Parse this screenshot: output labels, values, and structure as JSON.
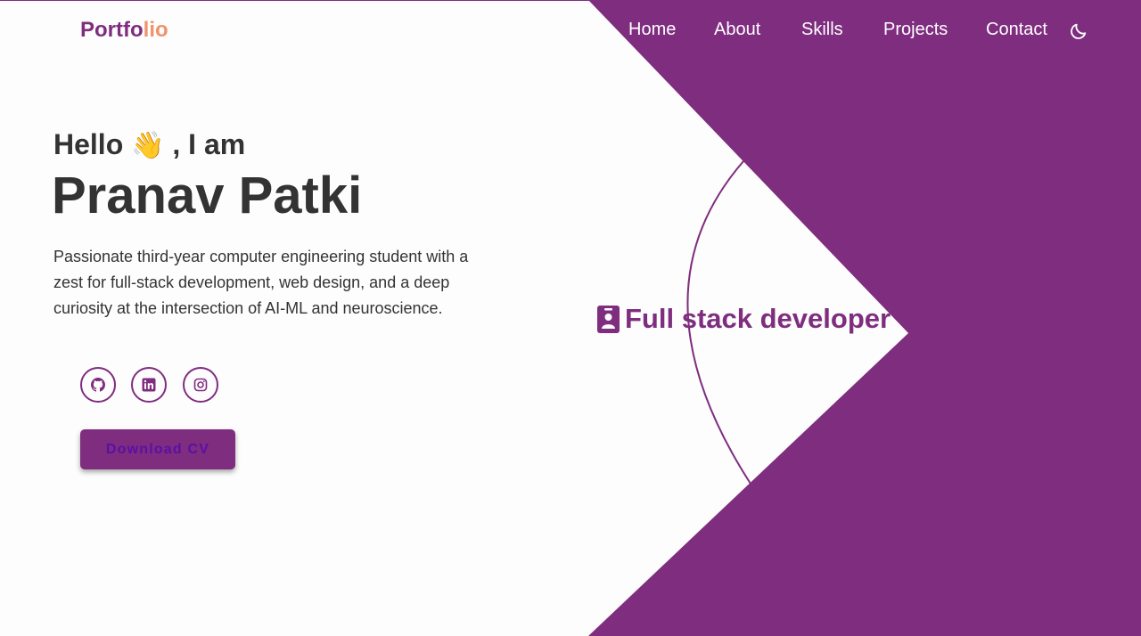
{
  "brand": {
    "logo_part1": "Portfo",
    "logo_part2": "lio",
    "colors": {
      "primary": "#7f2d7f",
      "accent": "#f0936b",
      "text": "#333333",
      "background": "#fdfdfd"
    }
  },
  "nav": {
    "items": [
      {
        "label": "Home"
      },
      {
        "label": "About"
      },
      {
        "label": "Skills"
      },
      {
        "label": "Projects"
      },
      {
        "label": "Contact"
      }
    ],
    "theme_toggle_icon": "moon-icon"
  },
  "hero": {
    "greeting_prefix": "Hello",
    "greeting_emoji": "👋",
    "greeting_suffix": ", I am",
    "name": "Pranav Patki",
    "bio": "Passionate third-year computer engineering student with a zest for full-stack development, web design, and a deep curiosity at the intersection of AI-ML and neuroscience.",
    "socials": [
      {
        "name": "GitHub",
        "icon": "github-icon"
      },
      {
        "name": "LinkedIn",
        "icon": "linkedin-icon"
      },
      {
        "name": "Instagram",
        "icon": "instagram-icon"
      }
    ],
    "cv_button_label": "Download CV",
    "role_icon": "id-badge-icon",
    "role": "Full stack developer"
  }
}
